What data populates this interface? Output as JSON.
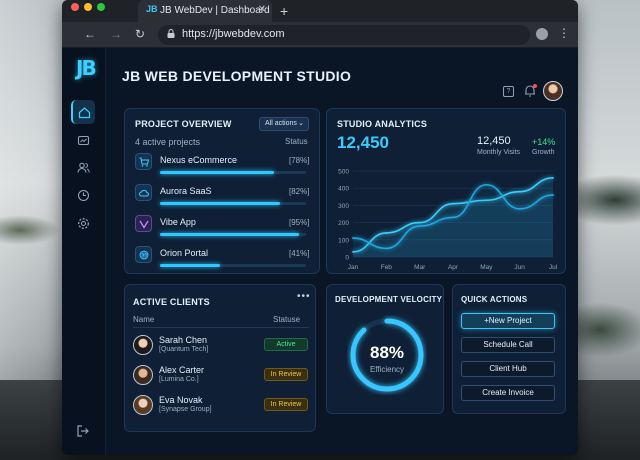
{
  "browser": {
    "tab_title": "JB WebDev | Dashboard",
    "tab_favicon": "JB",
    "url": "https://jbwebdev.com",
    "icons": [
      "back-icon",
      "forward-icon",
      "reload-icon",
      "lock-icon",
      "profile-icon",
      "kebab-menu-icon",
      "new-tab-icon",
      "close-tab-icon"
    ]
  },
  "app": {
    "logo": "JB",
    "title": "JB WEB DEVELOPMENT STUDIO",
    "sidebar": [
      "home-icon",
      "inbox-icon",
      "users-icon",
      "clock-icon",
      "settings-icon",
      "logout-icon"
    ]
  },
  "project_overview": {
    "title": "PROJECT OVERVIEW",
    "filter": "All actions",
    "subtitle": "4 active projects",
    "status_label": "Status",
    "projects": [
      {
        "name": "Nexus eCommerce",
        "pct": "[78%]",
        "progress": 0.78,
        "icon": "cart-icon"
      },
      {
        "name": "Aurora SaaS",
        "pct": "[82%]",
        "progress": 0.82,
        "icon": "cloud-icon"
      },
      {
        "name": "Vibe App",
        "pct": "[95%]",
        "progress": 0.95,
        "icon": "vibe-icon"
      },
      {
        "name": "Orion Portal",
        "pct": "[41%]",
        "progress": 0.41,
        "icon": "globe-icon"
      }
    ]
  },
  "analytics": {
    "title": "STUDIO ANALYTICS",
    "big_value": "12,450",
    "visits_value": "12,450",
    "visits_label": "Monthly Visits",
    "growth_value": "+14%",
    "growth_label": "Growth"
  },
  "chart_data": {
    "type": "line",
    "categories": [
      "Jan",
      "Feb",
      "Mar",
      "Apr",
      "May",
      "Jun",
      "Jul"
    ],
    "series": [
      {
        "values": [
          30,
          140,
          200,
          310,
          330,
          380,
          460
        ]
      },
      {
        "values": [
          110,
          50,
          180,
          230,
          420,
          280,
          360
        ]
      }
    ],
    "ylim": [
      0,
      500
    ],
    "yticks": [
      "500",
      "400",
      "300",
      "200",
      "100",
      "0"
    ],
    "grid": true
  },
  "clients": {
    "title": "ACTIVE CLIENTS",
    "col_name": "Name",
    "col_status": "Statuse",
    "rows": [
      {
        "name": "Sarah Chen",
        "company": "[Quantum Tech]",
        "status": "Active",
        "tone": "green"
      },
      {
        "name": "Alex Carter",
        "company": "[Lumina Co.]",
        "status": "In Review",
        "tone": "amber"
      },
      {
        "name": "Eva Novak",
        "company": "[Synapse Group]",
        "status": "In Review",
        "tone": "amber"
      }
    ]
  },
  "velocity": {
    "title": "DEVELOPMENT VELOCITY",
    "value": "88%",
    "progress": 0.88,
    "label": "Efficiency"
  },
  "quick_actions": {
    "title": "QUICK ACTIONS",
    "buttons": [
      "+New Project",
      "Schedule Call",
      "Client Hub",
      "Create Invoice"
    ]
  },
  "colors": {
    "accent": "#37c6ff",
    "green": "#4de39a",
    "amber": "#f0c34a"
  }
}
